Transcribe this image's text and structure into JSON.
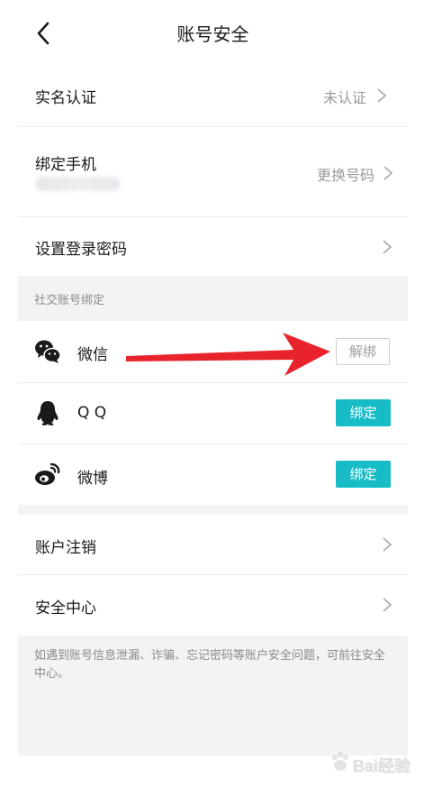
{
  "header": {
    "title": "账号安全"
  },
  "rows": {
    "realname": {
      "label": "实名认证",
      "status": "未认证"
    },
    "phone": {
      "label": "绑定手机",
      "action": "更换号码"
    },
    "password": {
      "label": "设置登录密码"
    }
  },
  "social": {
    "section_title": "社交账号绑定",
    "items": [
      {
        "label": "微信",
        "button": "解绑",
        "icon": "wechat-icon"
      },
      {
        "label": "Q Q",
        "button": "绑定",
        "icon": "qq-icon"
      },
      {
        "label": "微博",
        "button": "绑定",
        "icon": "weibo-icon"
      }
    ]
  },
  "account": {
    "cancel": {
      "label": "账户注销"
    },
    "security_center": {
      "label": "安全中心"
    }
  },
  "footnote": "如遇到账号信息泄漏、诈骗、忘记密码等账户安全问题，可前往安全中心。",
  "watermark": {
    "text": "Bai经验"
  },
  "colors": {
    "accent_teal": "#18bcc6",
    "annotation_red": "#e8232b"
  }
}
